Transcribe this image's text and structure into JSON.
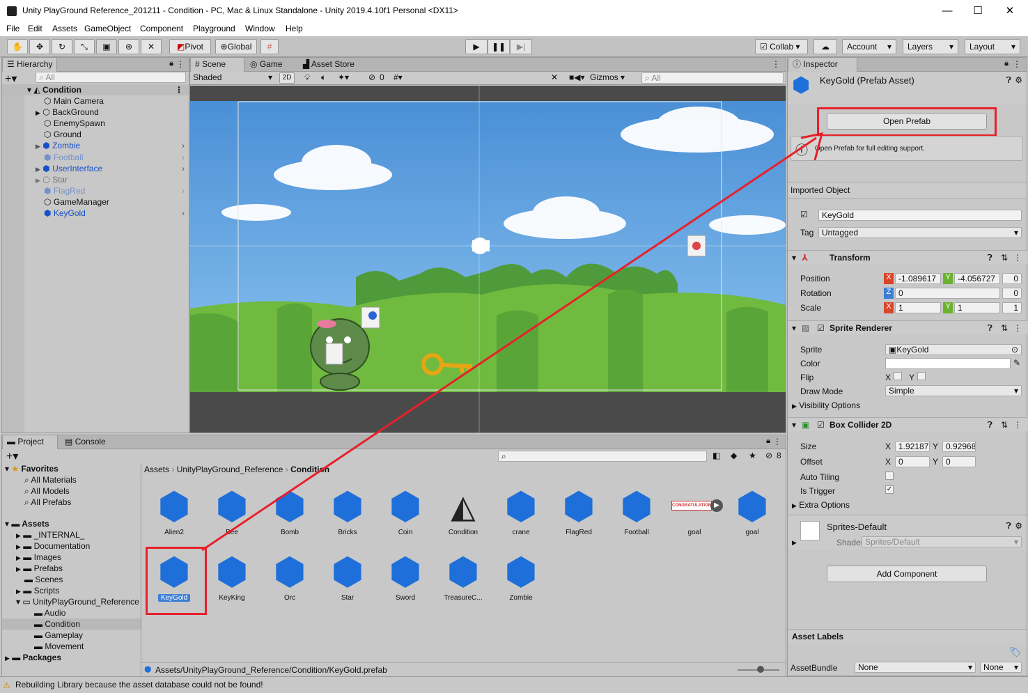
{
  "window": {
    "title": "Unity PlayGround Reference_201211 - Condition - PC, Mac & Linux Standalone - Unity 2019.4.10f1 Personal <DX11>",
    "minimize": "—",
    "maximize": "☐",
    "close": "✕"
  },
  "menu": [
    "File",
    "Edit",
    "Assets",
    "GameObject",
    "Component",
    "Playground",
    "Window",
    "Help"
  ],
  "toolbar": {
    "pivot": "Pivot",
    "global": "Global",
    "collab": "Collab",
    "account": "Account",
    "layers": "Layers",
    "layout": "Layout"
  },
  "hierarchy": {
    "tab": "Hierarchy",
    "search_placeholder": "All",
    "scene": "Condition",
    "items": [
      {
        "label": "Main Camera"
      },
      {
        "label": "BackGround"
      },
      {
        "label": "EnemySpawn"
      },
      {
        "label": "Ground"
      },
      {
        "label": "Zombie"
      },
      {
        "label": "Football"
      },
      {
        "label": "UserInterface"
      },
      {
        "label": "Star"
      },
      {
        "label": "FlagRed"
      },
      {
        "label": "GameManager"
      },
      {
        "label": "KeyGold"
      }
    ]
  },
  "scene": {
    "tabs": [
      "Scene",
      "Game",
      "Asset Store"
    ],
    "shading": "Shaded",
    "mode2d": "2D",
    "hidden_count": "0",
    "gizmos": "Gizmos",
    "search_placeholder": "All"
  },
  "inspector": {
    "tab": "Inspector",
    "asset_title": "KeyGold (Prefab Asset)",
    "open_prefab": "Open Prefab",
    "help_text": "Open Prefab for full editing support.",
    "imported_object": "Imported Object",
    "object_name": "KeyGold",
    "tag_label": "Tag",
    "tag_value": "Untagged",
    "transform": {
      "title": "Transform",
      "position_label": "Position",
      "position": {
        "x": "-1.089617",
        "y": "-4.056727",
        "z": "0"
      },
      "rotation_label": "Rotation",
      "rotation": {
        "z": "0",
        "w": "0"
      },
      "scale_label": "Scale",
      "scale": {
        "x": "1",
        "y": "1",
        "z": "1"
      }
    },
    "sprite_renderer": {
      "title": "Sprite Renderer",
      "sprite_label": "Sprite",
      "sprite_value": "KeyGold",
      "color_label": "Color",
      "flip_label": "Flip",
      "flip_x": "X",
      "flip_y": "Y",
      "draw_mode_label": "Draw Mode",
      "draw_mode_value": "Simple",
      "visibility_options": "Visibility Options"
    },
    "box_collider": {
      "title": "Box Collider 2D",
      "size_label": "Size",
      "size_x": "1.921875",
      "size_y": "0.92968",
      "offset_label": "Offset",
      "offset_x": "0",
      "offset_y": "0",
      "axis_x": "X",
      "axis_y": "Y",
      "auto_tiling": "Auto Tiling",
      "is_trigger": "Is Trigger",
      "extra_options": "Extra Options"
    },
    "material": {
      "name": "Sprites-Default",
      "shader_label": "Shader",
      "shader_value": "Sprites/Default"
    },
    "add_component": "Add Component",
    "asset_labels": "Asset Labels",
    "assetbundle_label": "AssetBundle",
    "assetbundle_value": "None",
    "variant_value": "None"
  },
  "project": {
    "tabs": [
      "Project",
      "Console"
    ],
    "hidden_count": "8",
    "breadcrumb": [
      "Assets",
      "UnityPlayGround_Reference",
      "Condition"
    ],
    "favorites_label": "Favorites",
    "favorites": [
      "All Materials",
      "All Models",
      "All Prefabs"
    ],
    "assets_label": "Assets",
    "folders": [
      "_INTERNAL_",
      "Documentation",
      "Images",
      "Prefabs",
      "Scenes",
      "Scripts",
      "UnityPlayGround_Reference"
    ],
    "subfolders": [
      "Audio",
      "Condition",
      "Gameplay",
      "Movement"
    ],
    "packages_label": "Packages",
    "assets_row1": [
      "Alien2",
      "Bee",
      "Bomb",
      "Bricks",
      "Coin",
      "Condition",
      "crane",
      "FlagRed",
      "Football",
      "goal",
      "goal"
    ],
    "assets_row2": [
      "KeyGold",
      "KeyKing",
      "Orc",
      "Star",
      "Sword",
      "TreasureC...",
      "Zombie"
    ],
    "goal_banner": "CONGRATULATIONS",
    "path": "Assets/UnityPlayGround_Reference/Condition/KeyGold.prefab"
  },
  "status": "Rebuilding Library because the asset database could not be found!",
  "colors": {
    "accent_red": "#e8202a",
    "cube_blue": "#1e6fd9",
    "selection": "#3d7fd6"
  }
}
